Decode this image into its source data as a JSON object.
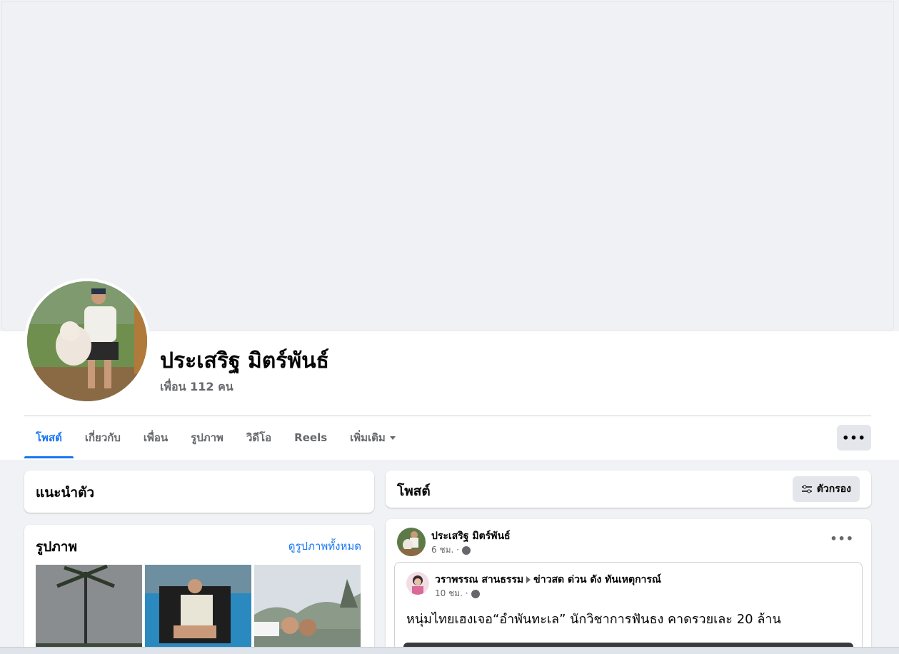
{
  "profile": {
    "name": "ประเสริฐ มิตร์พันธ์",
    "friends": "เพื่อน 112 คน"
  },
  "tabs": [
    {
      "label": "โพสต์",
      "active": true
    },
    {
      "label": "เกี่ยวกับ"
    },
    {
      "label": "เพื่อน"
    },
    {
      "label": "รูปภาพ"
    },
    {
      "label": "วิดีโอ"
    },
    {
      "label": "Reels"
    },
    {
      "label": "เพิ่มเติม"
    }
  ],
  "more_button": "•••",
  "intro": {
    "title": "แนะนำตัว"
  },
  "photos": {
    "title": "รูปภาพ",
    "see_all": "ดูรูปภาพทั้งหมด"
  },
  "posts": {
    "title": "โพสต์",
    "filter_label": "ตัวกรอง"
  },
  "post": {
    "author": "ประเสริฐ มิตร์พันธ์",
    "time": "6 ชม. ·",
    "menu": "•••",
    "shared": {
      "author": "วราพรรณ สานธรรม",
      "group": "ข่าวสด ด่วน ดัง ทันเหตุการณ์",
      "time": "10 ชม. ·",
      "text": "หนุ่มไทยเฮงเจอ“อำพันทะเล” นักวิชาการฟันธง คาดรวยเละ 20 ล้าน"
    }
  },
  "colors": {
    "accent": "#1877f2",
    "bg": "#f0f2f5",
    "muted": "#65676b"
  }
}
